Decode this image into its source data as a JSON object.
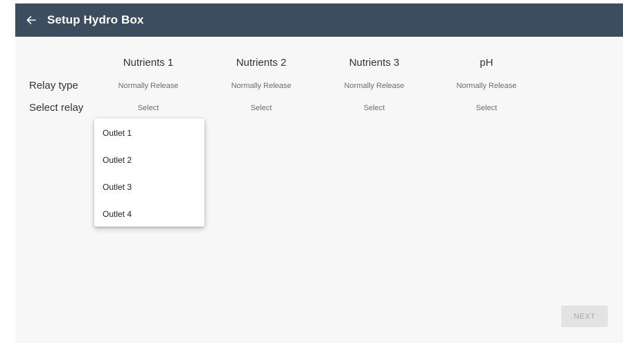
{
  "appbar": {
    "title": "Setup Hydro Box",
    "back_icon": "arrow-left-icon"
  },
  "columns": [
    {
      "header": "Nutrients 1",
      "relay_type": "Normally Release",
      "relay_select": "Select"
    },
    {
      "header": "Nutrients 2",
      "relay_type": "Normally Release",
      "relay_select": "Select"
    },
    {
      "header": "Nutrients 3",
      "relay_type": "Normally Release",
      "relay_select": "Select"
    },
    {
      "header": "pH",
      "relay_type": "Normally Release",
      "relay_select": "Select"
    }
  ],
  "rows": {
    "relay_type_label": "Relay type",
    "select_relay_label": "Select relay"
  },
  "dropdown": {
    "options": [
      "Outlet 1",
      "Outlet 2",
      "Outlet 3",
      "Outlet 4"
    ]
  },
  "footer": {
    "next_label": "NEXT"
  },
  "colors": {
    "appbar": "#3b4d5e",
    "background": "#f7f7f7",
    "text": "#333333",
    "disabled_button": "#e3e3e3"
  }
}
